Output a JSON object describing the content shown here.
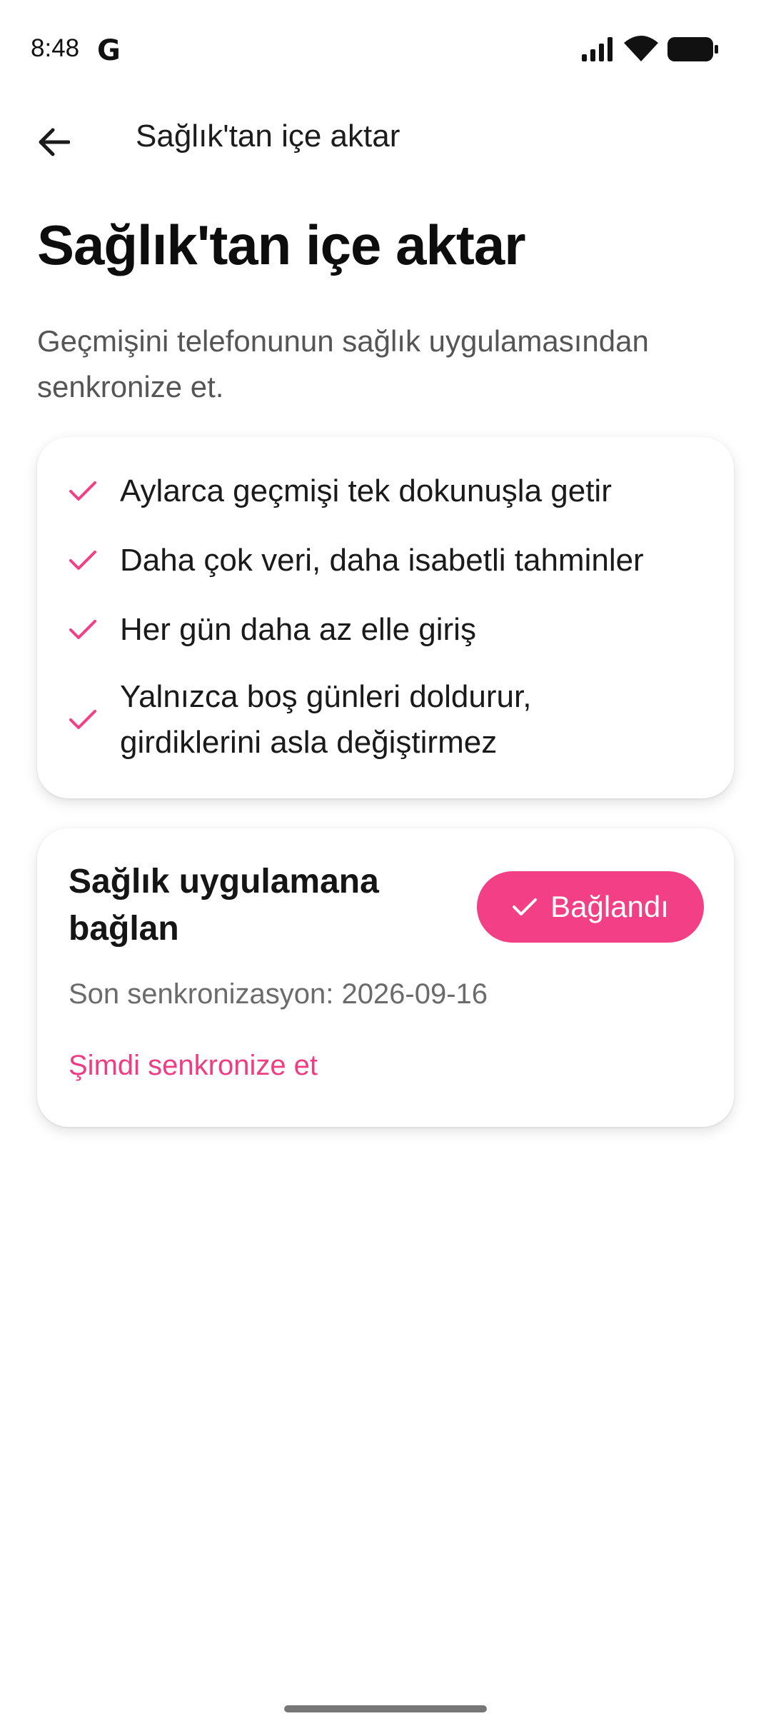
{
  "status_bar": {
    "time": "8:48",
    "google_icon": "G",
    "icons": [
      "signal-icon",
      "wifi-icon",
      "battery-icon"
    ]
  },
  "app_bar": {
    "back_icon": "arrow-left-icon",
    "title": "Sağlık'tan içe aktar"
  },
  "header": {
    "title": "Sağlık'tan içe aktar",
    "subtitle": "Geçmişini telefonunun sağlık uygulamasından senkronize et."
  },
  "features": {
    "items": [
      {
        "text": "Aylarca geçmişi tek dokunuşla getir"
      },
      {
        "text": "Daha çok veri, daha isabetli tahminler"
      },
      {
        "text": "Her gün daha az elle giriş"
      },
      {
        "text": "Yalnızca boş günleri doldurur, girdiklerini asla değiştirmez"
      }
    ]
  },
  "connect": {
    "title": "Sağlık uygulamana bağlan",
    "button_label": "Bağlandı",
    "last_sync": "Son senkronizasyon: 2026-09-16",
    "sync_now": "Şimdi senkronize et"
  },
  "colors": {
    "accent": "#f23f86",
    "text_primary": "#111111",
    "text_secondary": "#555555"
  }
}
